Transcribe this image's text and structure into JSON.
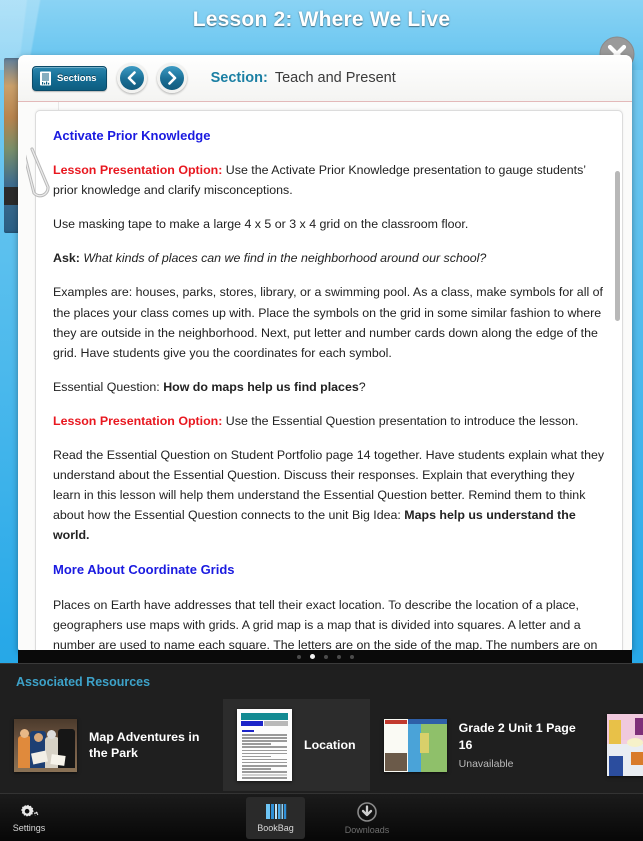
{
  "header": {
    "lesson_title": "Lesson 2: Where We Live",
    "close_icon": "close-icon"
  },
  "section_bar": {
    "sections_button": "Sections",
    "sections_icon": "document-list-icon",
    "prev_icon": "chevron-left-icon",
    "next_icon": "chevron-right-icon",
    "section_label": "Section:",
    "section_value": "Teach and Present"
  },
  "content": {
    "heading1": "Activate Prior Knowledge",
    "p1_lead": "Lesson Presentation Option:",
    "p1_rest": " Use the Activate Prior Knowledge presentation to gauge students’ prior knowledge and clarify misconceptions.",
    "p2": "Use masking tape to make a large 4 x 5 or 3 x 4 grid on the classroom floor.",
    "p3_lead": "Ask:",
    "p3_rest": "What kinds of places can we find in the neighborhood around our school?",
    "p4": "Examples are: houses, parks, stores, library, or a swimming pool. As a class, make symbols for all of the places your class comes up with. Place the symbols on the grid in some similar fashion to where they are outside in the neighborhood. Next, put letter and number cards down along the edge of the grid. Have students give you the coordinates for each symbol.",
    "p5_pre": "Essential Question: ",
    "p5_bold": "How do maps help us find places",
    "p5_post": "?",
    "p6_lead": "Lesson Presentation Option:",
    "p6_rest": " Use the Essential Question presentation to introduce the lesson.",
    "p7_pre": "Read the Essential Question on Student Portfolio page 14 together. Have students explain what they understand about the Essential Question. Discuss their responses. Explain that everything they learn in this lesson will help them understand the Essential Question better. Remind them to think about how the Essential Question connects to the unit Big Idea: ",
    "p7_bold": "Maps help us understand the world.",
    "heading2": "More About Coordinate Grids",
    "p8": "Places on Earth have addresses that tell their exact location. To describe the location of a place, geographers use maps with grids. A grid map is a map that is divided into squares. A letter and a number are used to name each square. The letters are on the side of the map. The numbers are on the top or bottom of the map. Drawing a grid over a map is a way to break a large map into small sections. Each section is the same size and shape. The grid makes it easy to find locations on the map."
  },
  "pager": {
    "total": 5,
    "active_index": 1
  },
  "resources": {
    "title": "Associated Resources",
    "items": [
      {
        "name": "Map Adventures in the Park",
        "status": "",
        "selected": false,
        "thumb": "photo-kids-with-map-thumbnail"
      },
      {
        "name": "Location",
        "status": "",
        "selected": true,
        "thumb": "document-page-thumbnail"
      },
      {
        "name": "Grade 2 Unit 1 Page 16",
        "status": "Unavailable",
        "selected": false,
        "thumb": "map-page-thumbnail"
      },
      {
        "name": "",
        "status": "",
        "selected": false,
        "thumb": "illustration-thumbnail"
      }
    ]
  },
  "tabbar": {
    "settings": {
      "label": "Settings",
      "icon": "gear-icon"
    },
    "bookbag": {
      "label": "BookBag",
      "icon": "books-icon"
    },
    "downloads": {
      "label": "Downloads",
      "icon": "download-arrow-icon"
    }
  },
  "colors": {
    "accent_blue": "#1a7fa3",
    "red": "#e8171f",
    "heading_blue": "#1a1ae0",
    "resource_title": "#3da2c9"
  }
}
